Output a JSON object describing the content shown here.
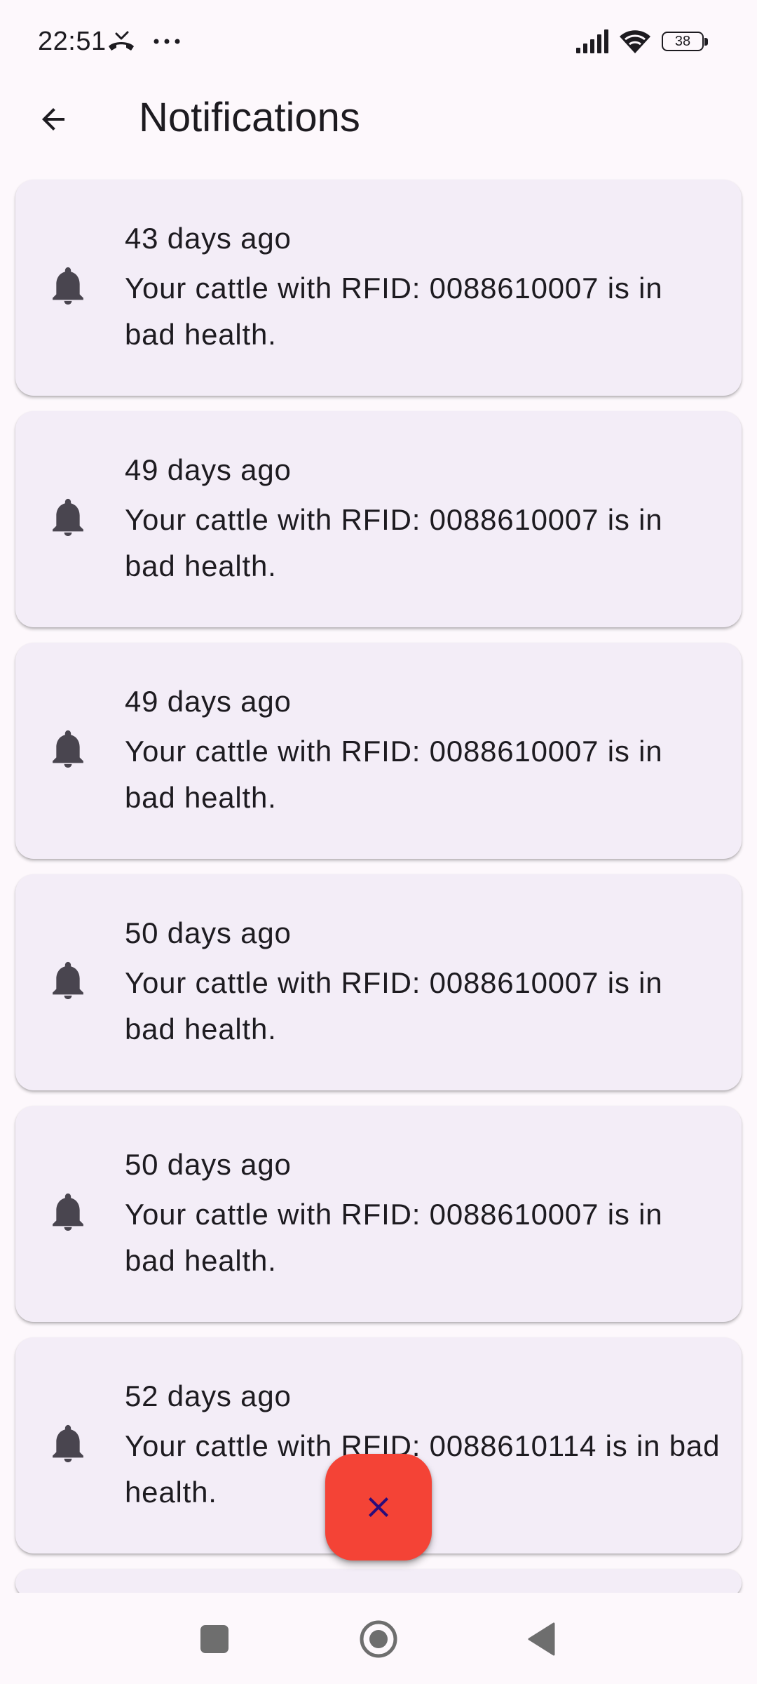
{
  "status_bar": {
    "time": "22:51",
    "battery_level": "38",
    "icons": [
      "missed-call-icon",
      "more-dots-icon",
      "cell-signal-icon",
      "wifi-icon",
      "battery-icon"
    ]
  },
  "app_bar": {
    "title": "Notifications",
    "back_icon": "arrow-back-icon"
  },
  "notifications": [
    {
      "time": "43 days ago",
      "message": "Your cattle with RFID: 0088610007 is in bad health.",
      "icon": "bell-icon"
    },
    {
      "time": "49 days ago",
      "message": "Your cattle with RFID: 0088610007 is in bad health.",
      "icon": "bell-icon"
    },
    {
      "time": "49 days ago",
      "message": "Your cattle with RFID: 0088610007 is in bad health.",
      "icon": "bell-icon"
    },
    {
      "time": "50 days ago",
      "message": "Your cattle with RFID: 0088610007 is in bad health.",
      "icon": "bell-icon"
    },
    {
      "time": "50 days ago",
      "message": "Your cattle with RFID: 0088610007 is in bad health.",
      "icon": "bell-icon"
    },
    {
      "time": "52 days ago",
      "message": "Your cattle with RFID: 0088610114 is in bad health.",
      "icon": "bell-icon"
    }
  ],
  "fab": {
    "icon": "close-icon",
    "background_color": "#F44336",
    "icon_color": "#2A0C7A"
  },
  "colors": {
    "background": "#FDF8FC",
    "card": "#F3EDF7",
    "text": "#1D1B20",
    "icon": "#49454F"
  },
  "nav_bar": {
    "buttons": [
      "recents-square-icon",
      "home-circle-icon",
      "back-triangle-icon"
    ]
  }
}
